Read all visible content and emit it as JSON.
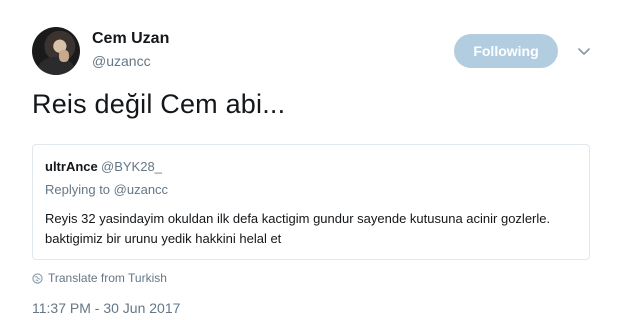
{
  "author": {
    "name": "Cem Uzan",
    "handle": "@uzancc"
  },
  "follow_button": {
    "label": "Following"
  },
  "tweet": {
    "text": "Reis değil Cem abi..."
  },
  "quoted_tweet": {
    "author_name": "ultrAnce",
    "author_handle": "@BYK28_",
    "replying_prefix": "Replying to",
    "replying_to": "@uzancc",
    "text": "Reyis 32 yasindayim okuldan ilk defa kactigim gundur sayende kutusuna acinir gozlerle. baktigimiz bir urunu yedik hakkini helal et"
  },
  "translate_link": {
    "label": "Translate from Turkish"
  },
  "timestamp": "11:37 PM - 30 Jun 2017",
  "colors": {
    "follow_bg": "#b3cde0",
    "muted_text": "#657786",
    "primary_text": "#14171a",
    "border": "#e1e8ed"
  },
  "icons": {
    "dropdown": "chevron-down-icon",
    "translate": "globe-icon"
  }
}
